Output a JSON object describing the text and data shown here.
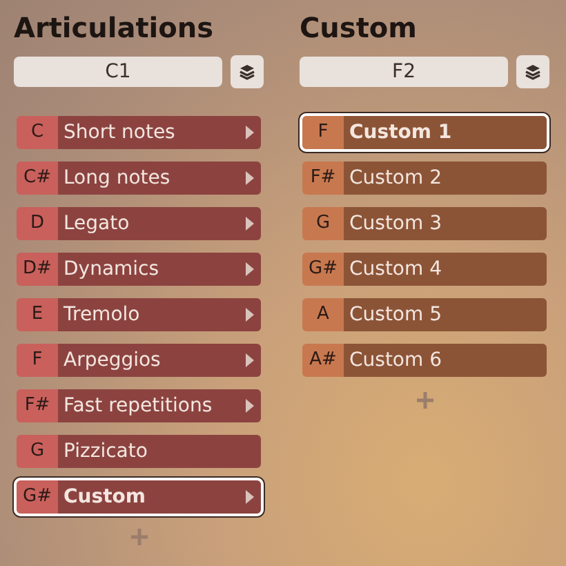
{
  "panels": [
    {
      "title": "Articulations",
      "field_value": "C1",
      "color": "#c9605c",
      "items": [
        {
          "key": "C",
          "label": "Short notes",
          "submenu": true,
          "selected": false
        },
        {
          "key": "C#",
          "label": "Long notes",
          "submenu": true,
          "selected": false
        },
        {
          "key": "D",
          "label": "Legato",
          "submenu": true,
          "selected": false
        },
        {
          "key": "D#",
          "label": "Dynamics",
          "submenu": true,
          "selected": false
        },
        {
          "key": "E",
          "label": "Tremolo",
          "submenu": true,
          "selected": false
        },
        {
          "key": "F",
          "label": "Arpeggios",
          "submenu": true,
          "selected": false
        },
        {
          "key": "F#",
          "label": "Fast repetitions",
          "submenu": true,
          "selected": false
        },
        {
          "key": "G",
          "label": "Pizzicato",
          "submenu": false,
          "selected": false
        },
        {
          "key": "G#",
          "label": "Custom",
          "submenu": true,
          "selected": true
        }
      ]
    },
    {
      "title": "Custom",
      "field_value": "F2",
      "color": "#c8784f",
      "items": [
        {
          "key": "F",
          "label": "Custom 1",
          "submenu": false,
          "selected": true
        },
        {
          "key": "F#",
          "label": "Custom 2",
          "submenu": false,
          "selected": false
        },
        {
          "key": "G",
          "label": "Custom 3",
          "submenu": false,
          "selected": false
        },
        {
          "key": "G#",
          "label": "Custom 4",
          "submenu": false,
          "selected": false
        },
        {
          "key": "A",
          "label": "Custom 5",
          "submenu": false,
          "selected": false
        },
        {
          "key": "A#",
          "label": "Custom 6",
          "submenu": false,
          "selected": false
        }
      ]
    }
  ]
}
